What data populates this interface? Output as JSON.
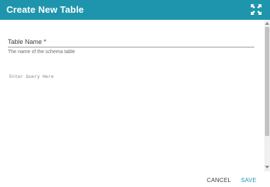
{
  "dialog": {
    "title": "Create New Table",
    "expand_icon": "expand-arrows-icon",
    "header_color": "#1f95ad"
  },
  "form": {
    "table_name": {
      "label": "Table Name *",
      "value": "",
      "helper": "The name of the schema table"
    },
    "query": {
      "placeholder": "Enter Query Here",
      "value": ""
    }
  },
  "footer": {
    "cancel_label": "CANCEL",
    "save_label": "SAVE",
    "save_color": "#1f95ad"
  }
}
